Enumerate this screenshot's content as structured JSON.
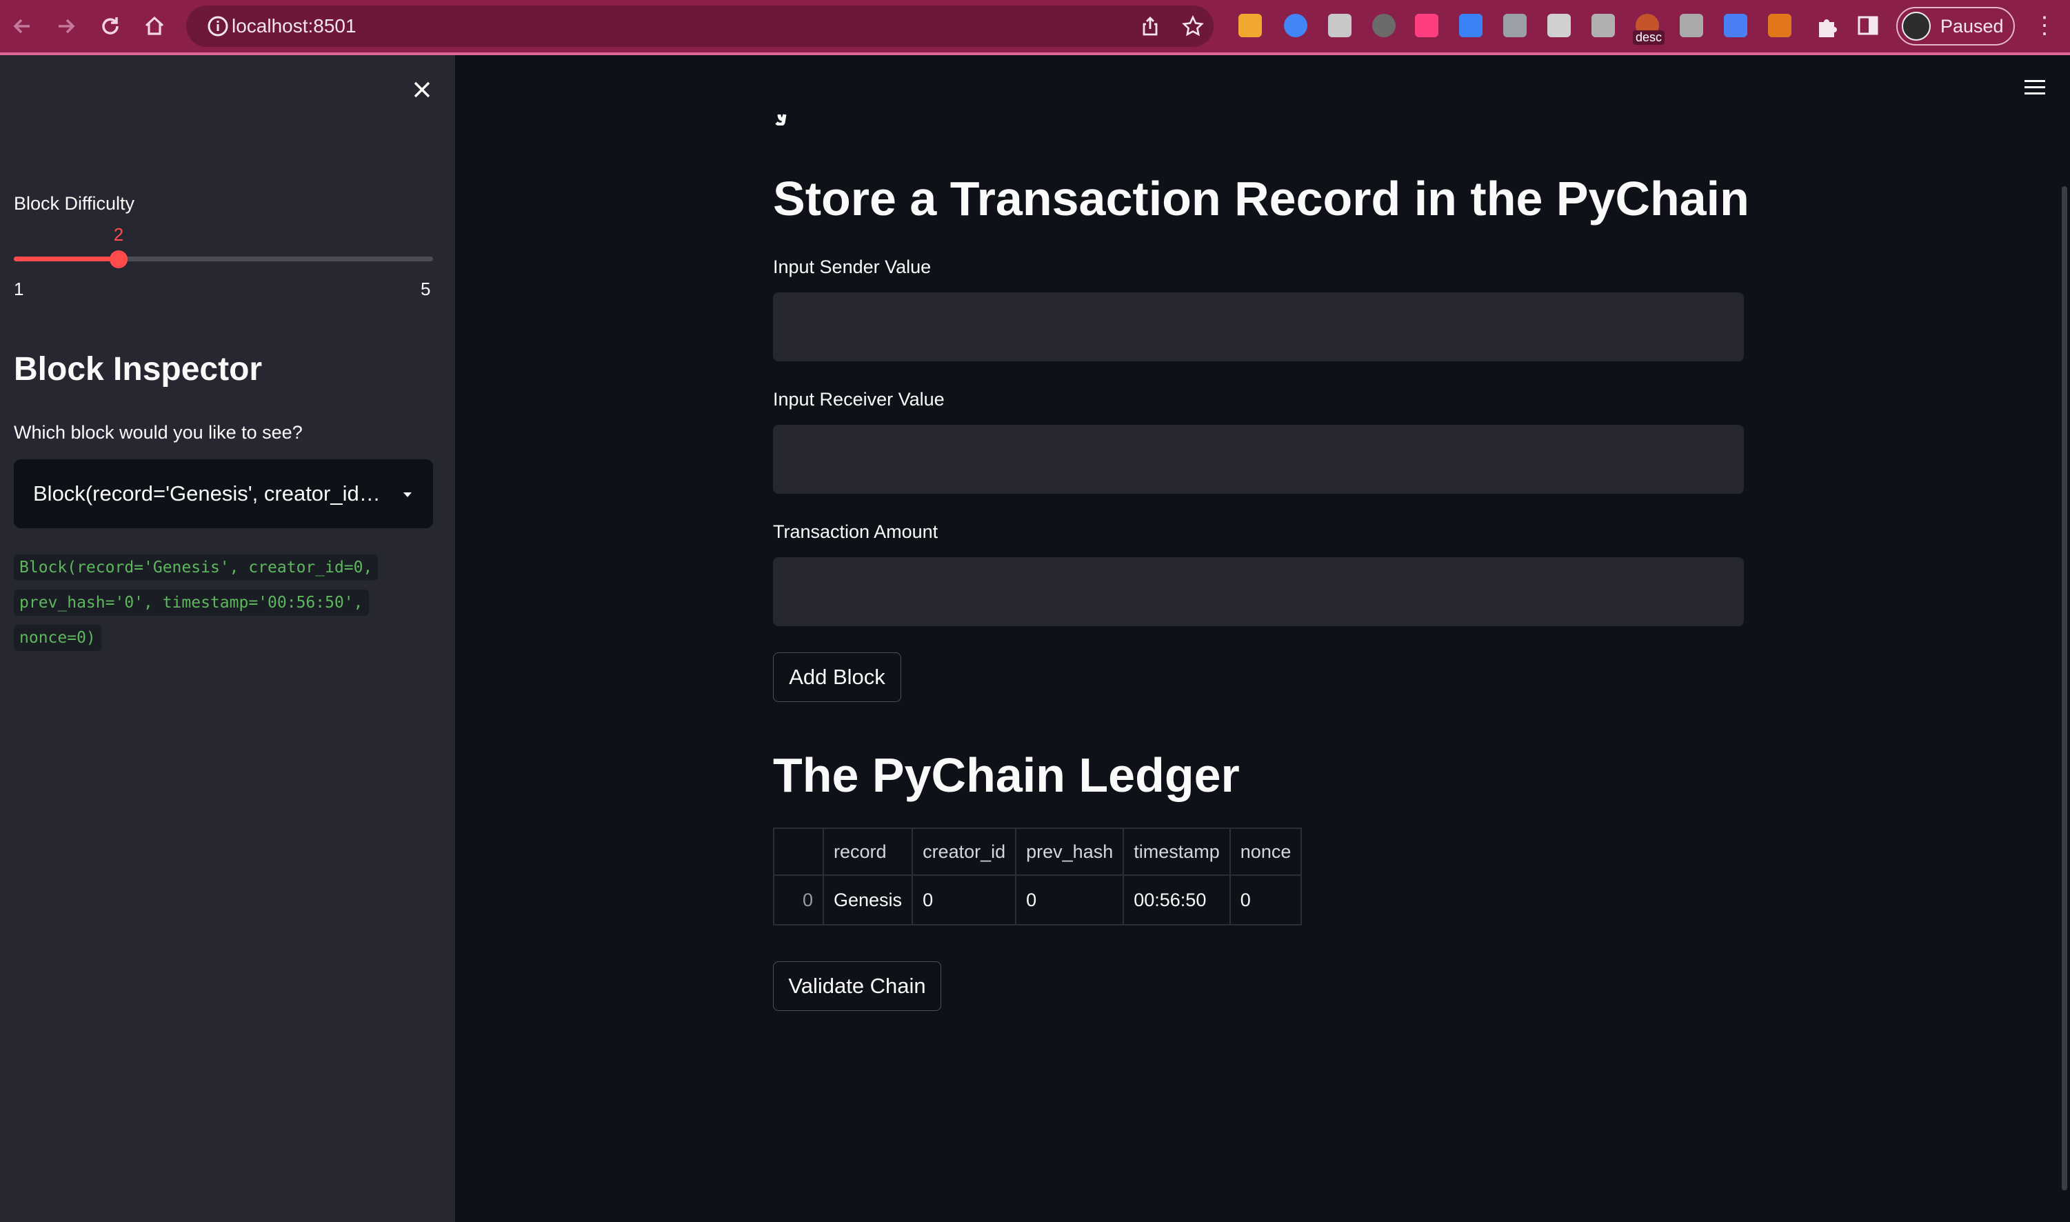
{
  "browser": {
    "url": "localhost:8501",
    "profile_status": "Paused",
    "extension_badge": "desc",
    "extension_colors": [
      "#f0a830",
      "#4285f4",
      "#c8c8c8",
      "#6b6b6b",
      "#ff3d7f",
      "#3b82f6",
      "#9aa0a6",
      "#d0d0d0",
      "#b0b0b0",
      "#c6542a",
      "#aaaaaa",
      "#4a7ff5",
      "#e2761b"
    ]
  },
  "sidebar": {
    "difficulty": {
      "label": "Block Difficulty",
      "value": "2",
      "min": "1",
      "max": "5",
      "level": 2
    },
    "inspector": {
      "title": "Block Inspector",
      "question": "Which block would you like to see?",
      "selected": "Block(record='Genesis', creator_id=0, prev_hash='0', timestamp='00:56:50', nonce=0)",
      "code": "Block(record='Genesis', creator_id=0, prev_hash='0', timestamp='00:56:50', nonce=0)"
    }
  },
  "main": {
    "store_title": "Store a Transaction Record in the PyChain",
    "fields": [
      {
        "label": "Input Sender Value",
        "value": ""
      },
      {
        "label": "Input Receiver Value",
        "value": ""
      },
      {
        "label": "Transaction Amount",
        "value": ""
      }
    ],
    "add_block_label": "Add Block",
    "ledger_title": "The PyChain Ledger",
    "ledger": {
      "columns": [
        "",
        "record",
        "creator_id",
        "prev_hash",
        "timestamp",
        "nonce"
      ],
      "rows": [
        [
          "0",
          "Genesis",
          "0",
          "0",
          "00:56:50",
          "0"
        ]
      ]
    },
    "validate_label": "Validate Chain"
  },
  "colors": {
    "accent": "#ff4b4b",
    "code_text": "#5cb85c",
    "chrome": "#8a1f4a"
  }
}
